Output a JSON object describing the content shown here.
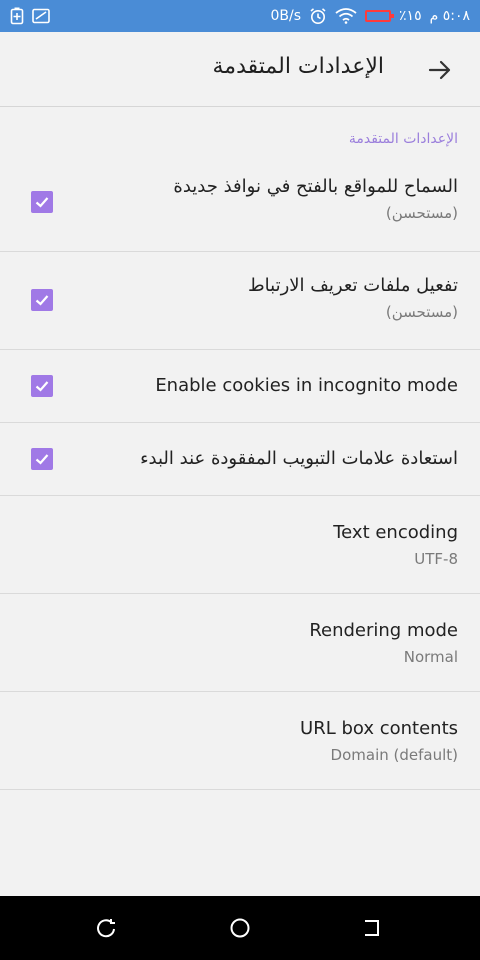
{
  "status_bar": {
    "time": "٥:٠٨ م",
    "battery": "٪١٥",
    "speed": "0B/s"
  },
  "app_bar": {
    "title": "الإعدادات المتقدمة"
  },
  "settings": {
    "section_header": "الإعدادات المتقدمة",
    "items": [
      {
        "title": "السماح للمواقع بالفتح في نوافذ جديدة",
        "summary": "(مستحسن)",
        "checked": true
      },
      {
        "title": "تفعيل ملفات تعريف الارتباط",
        "summary": "(مستحسن)",
        "checked": true
      },
      {
        "title": "Enable cookies in incognito mode",
        "checked": true
      },
      {
        "title": "استعادة علامات التبويب المفقودة عند البدء",
        "checked": true
      },
      {
        "title": "Text encoding",
        "summary": "UTF-8"
      },
      {
        "title": "Rendering mode",
        "summary": "Normal"
      },
      {
        "title": "URL box contents",
        "summary": "Domain (default)"
      }
    ]
  },
  "colors": {
    "status_bar": "#4a8cd6",
    "accent": "#a079e6",
    "section_header": "#9b7fdc",
    "background": "#f2f2f2"
  },
  "icons": {
    "status_left": [
      "battery-saver-icon",
      "screenshot-icon"
    ],
    "status_right": [
      "alarm-icon",
      "wifi-icon",
      "battery-icon"
    ],
    "app_bar": "arrow-right-icon",
    "nav_bar": [
      "recents-icon",
      "home-icon",
      "back-icon"
    ]
  }
}
